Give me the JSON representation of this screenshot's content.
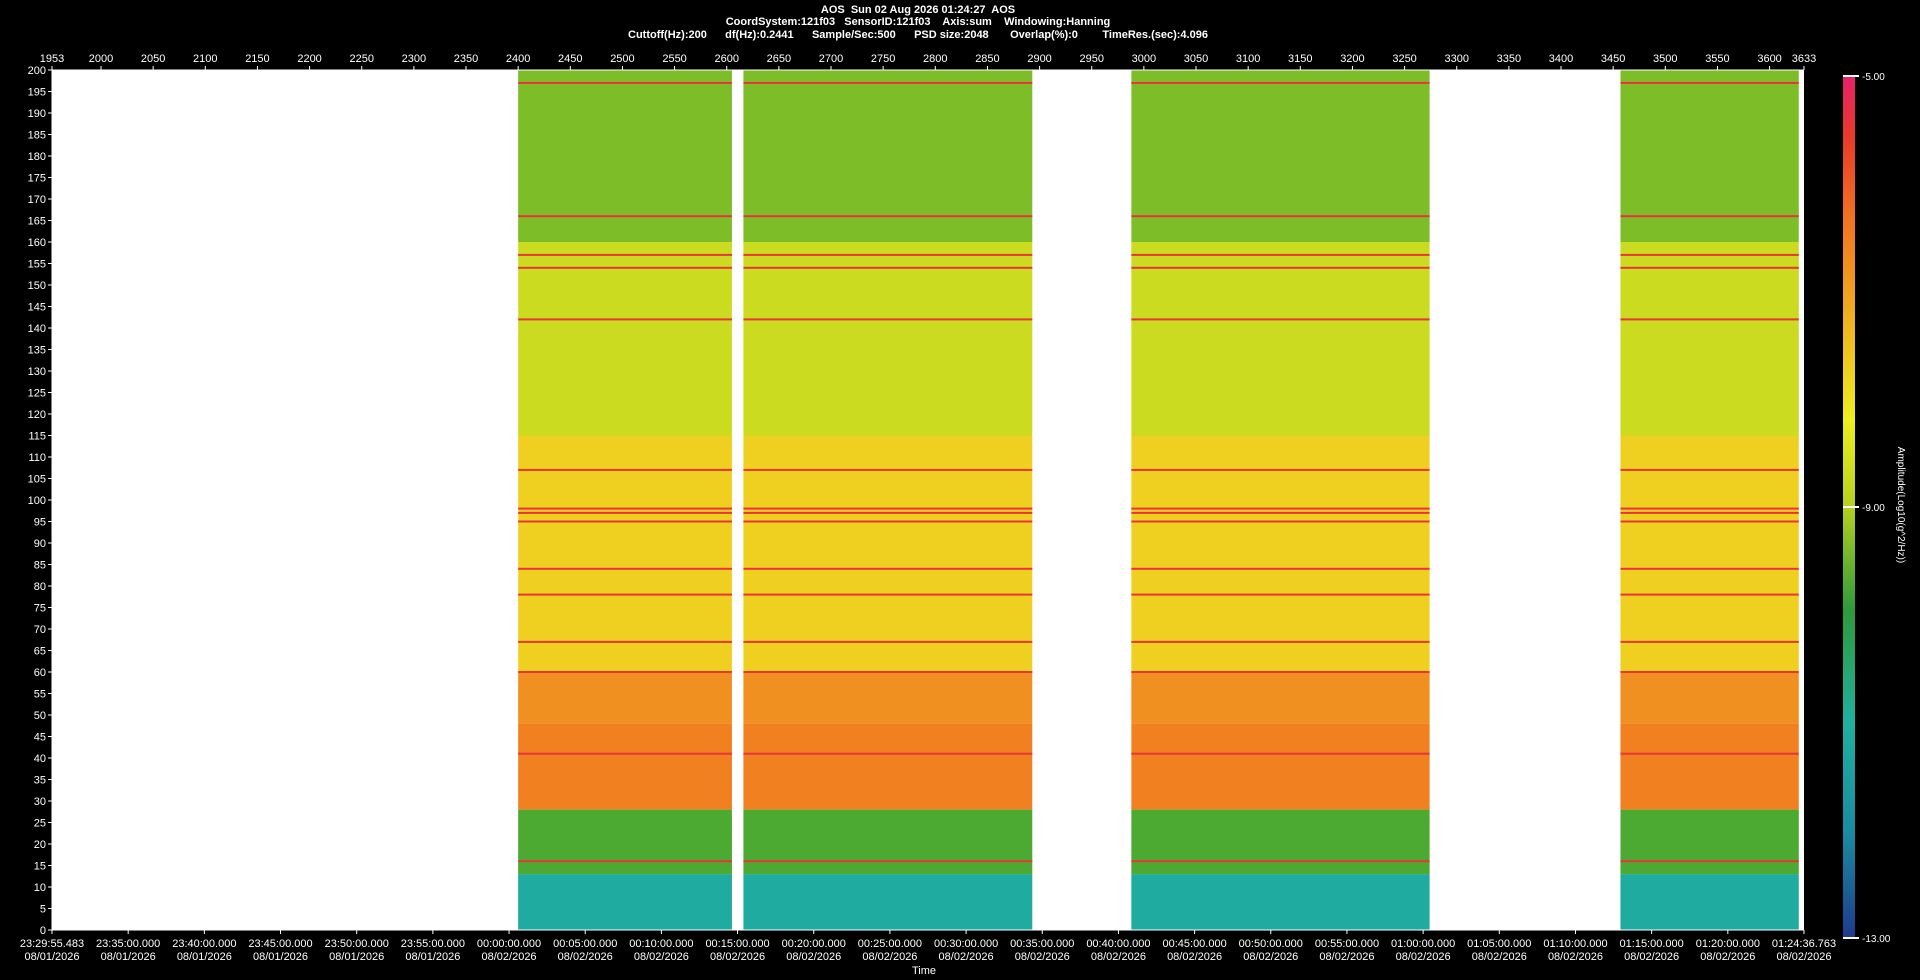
{
  "header": {
    "line1": "AOS  Sun 02 Aug 2026 01:24:27  AOS",
    "line2": "CoordSystem:121f03   SensorID:121f03    Axis:sum    Windowing:Hanning",
    "line3": "Cuttoff(Hz):200      df(Hz):0.2441      Sample/Sec:500      PSD size:2048       Overlap(%):0        TimeRes.(sec):4.096"
  },
  "colors": {
    "background": "#000000",
    "plot_bg": "#ffffff",
    "colormap": [
      "#1e3a8c",
      "#1a8aa0",
      "#20b0a0",
      "#2e9a3a",
      "#6ab82a",
      "#b4d020",
      "#eeee20",
      "#f0b020",
      "#f07020",
      "#e83a2a",
      "#e8206a"
    ]
  },
  "chart_data": {
    "type": "heatmap",
    "title": "AOS  Sun 02 Aug 2026 01:24:27  AOS",
    "xlabel": "Time",
    "ylabel": "",
    "colorbar_label": "Amplitude(Log10(g^2/Hz))",
    "colorbar_ticks": [
      "-5.00",
      "-9.00",
      "-13.00"
    ],
    "colorbar_range": [
      -13,
      -5
    ],
    "ylim": [
      0,
      200
    ],
    "y_ticks": [
      200,
      195,
      190,
      185,
      180,
      175,
      170,
      165,
      160,
      155,
      150,
      145,
      140,
      135,
      130,
      125,
      120,
      115,
      110,
      105,
      100,
      95,
      90,
      85,
      80,
      75,
      70,
      65,
      60,
      55,
      50,
      45,
      40,
      35,
      30,
      25,
      20,
      15,
      10,
      5,
      0
    ],
    "top_axis_range": [
      1953,
      3633
    ],
    "top_ticks": [
      1953,
      2000,
      2050,
      2100,
      2150,
      2200,
      2250,
      2300,
      2350,
      2400,
      2450,
      2500,
      2550,
      2600,
      2650,
      2700,
      2750,
      2800,
      2850,
      2900,
      2950,
      3000,
      3050,
      3100,
      3150,
      3200,
      3250,
      3300,
      3350,
      3400,
      3450,
      3500,
      3550,
      3600,
      3633
    ],
    "time_ticks": [
      {
        "time": "23:29:55.483",
        "date": "08/01/2026"
      },
      {
        "time": "23:35:00.000",
        "date": "08/01/2026"
      },
      {
        "time": "23:40:00.000",
        "date": "08/01/2026"
      },
      {
        "time": "23:45:00.000",
        "date": "08/01/2026"
      },
      {
        "time": "23:50:00.000",
        "date": "08/01/2026"
      },
      {
        "time": "23:55:00.000",
        "date": "08/01/2026"
      },
      {
        "time": "00:00:00.000",
        "date": "08/02/2026"
      },
      {
        "time": "00:05:00.000",
        "date": "08/02/2026"
      },
      {
        "time": "00:10:00.000",
        "date": "08/02/2026"
      },
      {
        "time": "00:15:00.000",
        "date": "08/02/2026"
      },
      {
        "time": "00:20:00.000",
        "date": "08/02/2026"
      },
      {
        "time": "00:25:00.000",
        "date": "08/02/2026"
      },
      {
        "time": "00:30:00.000",
        "date": "08/02/2026"
      },
      {
        "time": "00:35:00.000",
        "date": "08/02/2026"
      },
      {
        "time": "00:40:00.000",
        "date": "08/02/2026"
      },
      {
        "time": "00:45:00.000",
        "date": "08/02/2026"
      },
      {
        "time": "00:50:00.000",
        "date": "08/02/2026"
      },
      {
        "time": "00:55:00.000",
        "date": "08/02/2026"
      },
      {
        "time": "01:00:00.000",
        "date": "08/02/2026"
      },
      {
        "time": "01:05:00.000",
        "date": "08/02/2026"
      },
      {
        "time": "01:10:00.000",
        "date": "08/02/2026"
      },
      {
        "time": "01:15:00.000",
        "date": "08/02/2026"
      },
      {
        "time": "01:20:00.000",
        "date": "08/02/2026"
      },
      {
        "time": "01:24:36.763",
        "date": "08/02/2026"
      }
    ],
    "data_segments": [
      {
        "start": 2400,
        "end": 2605
      },
      {
        "start": 2616,
        "end": 2893
      },
      {
        "start": 2988,
        "end": 3274
      },
      {
        "start": 3457,
        "end": 3628
      }
    ],
    "spectral_lines_hz": [
      197,
      166,
      157,
      154,
      142,
      107,
      98,
      97,
      95,
      84,
      78,
      67,
      60,
      41,
      16
    ],
    "bands": [
      {
        "hz_range": [
          0,
          13
        ],
        "level": -11.5
      },
      {
        "hz_range": [
          13,
          28
        ],
        "level": -10.2
      },
      {
        "hz_range": [
          28,
          48
        ],
        "level": -6.8
      },
      {
        "hz_range": [
          48,
          60
        ],
        "level": -7.0
      },
      {
        "hz_range": [
          60,
          115
        ],
        "level": -7.8
      },
      {
        "hz_range": [
          115,
          160
        ],
        "level": -8.7
      },
      {
        "hz_range": [
          160,
          200
        ],
        "level": -9.6
      }
    ]
  }
}
